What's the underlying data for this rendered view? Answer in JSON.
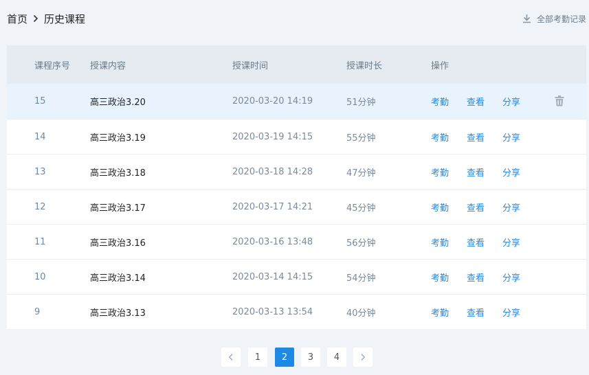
{
  "breadcrumb": {
    "home": "首页",
    "current": "历史课程"
  },
  "export_label": "全部考勤记录",
  "table": {
    "headers": {
      "id": "课程序号",
      "content": "授课内容",
      "time": "授课时间",
      "duration": "授课时长",
      "actions": "操作"
    },
    "rows": [
      {
        "id": "15",
        "content": "高三政治3.20",
        "time": "2020-03-20 14:19",
        "duration": "51分钟"
      },
      {
        "id": "14",
        "content": "高三政治3.19",
        "time": "2020-03-19 14:15",
        "duration": "55分钟"
      },
      {
        "id": "13",
        "content": "高三政治3.18",
        "time": "2020-03-18 14:28",
        "duration": "47分钟"
      },
      {
        "id": "12",
        "content": "高三政治3.17",
        "time": "2020-03-17 14:21",
        "duration": "45分钟"
      },
      {
        "id": "11",
        "content": "高三政治3.16",
        "time": "2020-03-16 13:48",
        "duration": "56分钟"
      },
      {
        "id": "10",
        "content": "高三政治3.14",
        "time": "2020-03-14 14:15",
        "duration": "54分钟"
      },
      {
        "id": "9",
        "content": "高三政治3.13",
        "time": "2020-03-13 13:54",
        "duration": "40分钟"
      }
    ],
    "actions": {
      "attendance": "考勤",
      "view": "查看",
      "share": "分享"
    }
  },
  "pagination": {
    "pages": [
      "1",
      "2",
      "3",
      "4"
    ],
    "current": "2",
    "prev_icon": "chevron-left-icon",
    "next_icon": "chevron-right-icon"
  },
  "colors": {
    "accent": "#1e88e5",
    "link": "#2b8ad8",
    "header_bg": "#e5ebf1",
    "highlight_row": "#e8f3fd"
  }
}
